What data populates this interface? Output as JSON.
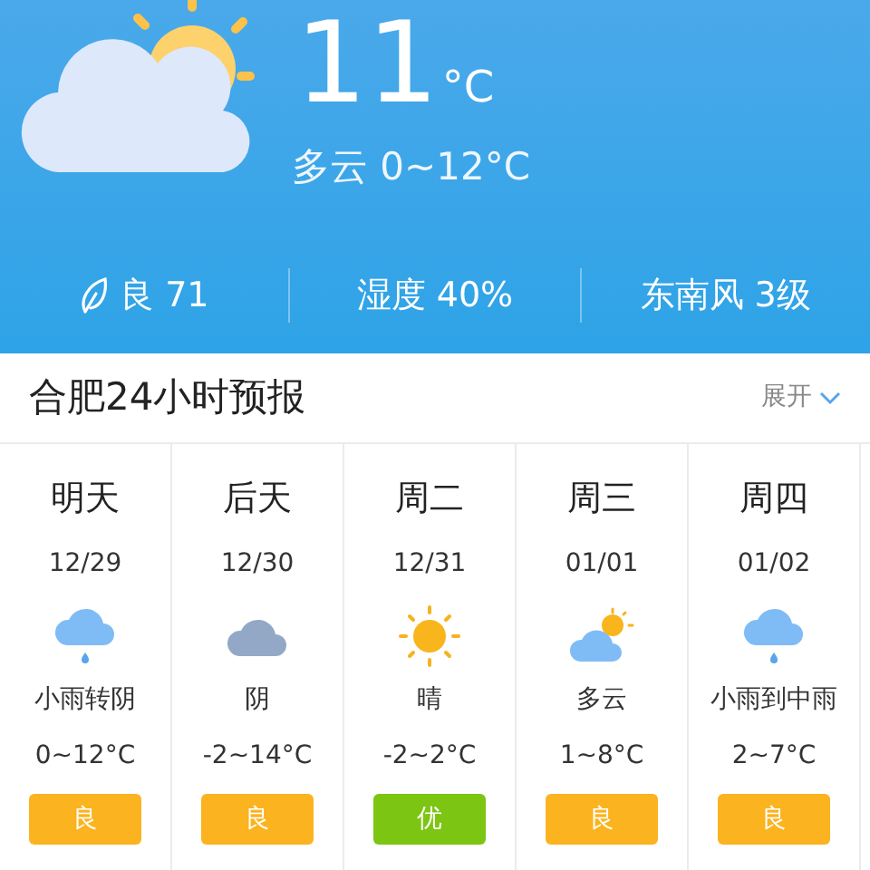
{
  "current": {
    "temperature": "11",
    "unit": "°C",
    "summary": "多云 0~12°C",
    "kind": "partly_cloudy"
  },
  "stats": [
    {
      "kind": "air",
      "text": "良 71"
    },
    {
      "kind": "plain",
      "text": "湿度 40%"
    },
    {
      "kind": "plain",
      "text": "东南风 3级"
    }
  ],
  "forecast": {
    "title": "合肥24小时预报",
    "expand": "展开",
    "days": [
      {
        "day": "明天",
        "date": "12/29",
        "kind": "rain",
        "weather": "小雨转阴",
        "temp": "0~12°C",
        "aqi": "良",
        "color": "#fbb31f"
      },
      {
        "day": "后天",
        "date": "12/30",
        "kind": "overcast",
        "weather": "阴",
        "temp": "-2~14°C",
        "aqi": "良",
        "color": "#fbb31f"
      },
      {
        "day": "周二",
        "date": "12/31",
        "kind": "sunny",
        "weather": "晴",
        "temp": "-2~2°C",
        "aqi": "优",
        "color": "#7cc512"
      },
      {
        "day": "周三",
        "date": "01/01",
        "kind": "partly_cloudy",
        "weather": "多云",
        "temp": "1~8°C",
        "aqi": "良",
        "color": "#fbb31f"
      },
      {
        "day": "周四",
        "date": "01/02",
        "kind": "rain",
        "weather": "小雨到中雨",
        "temp": "2~7°C",
        "aqi": "良",
        "color": "#fbb31f"
      }
    ]
  }
}
